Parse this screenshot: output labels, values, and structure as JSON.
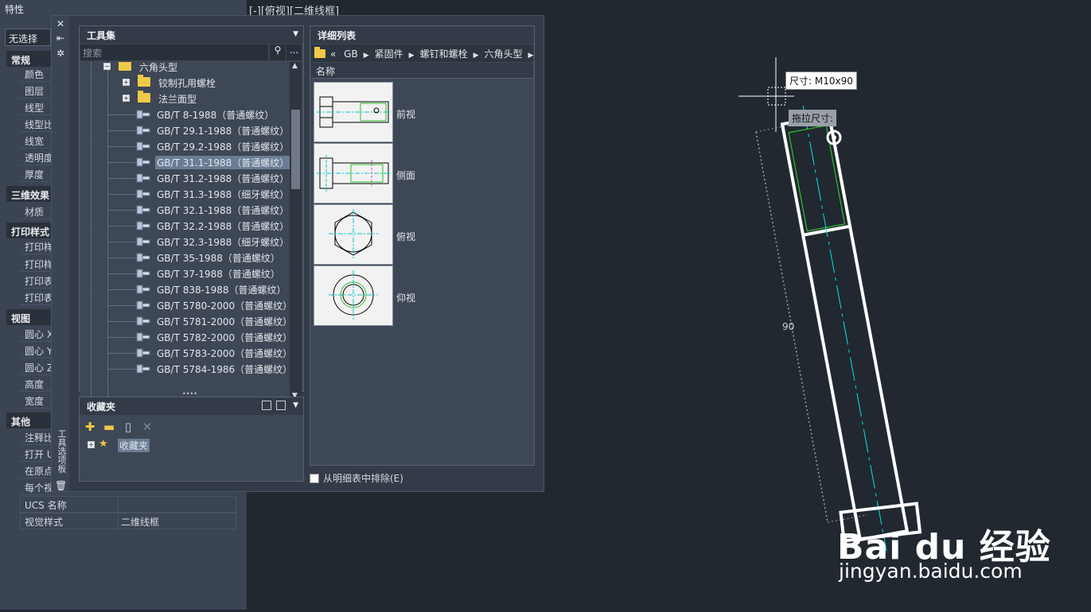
{
  "properties_palette": {
    "title": "特性",
    "selection": "无选择",
    "sections": [
      {
        "name": "常规",
        "rows": [
          "颜色",
          "图层",
          "线型",
          "线型比",
          "线宽",
          "透明度",
          "厚度"
        ]
      },
      {
        "name": "三维效果",
        "rows": [
          "材质"
        ]
      },
      {
        "name": "打印样式",
        "rows": [
          "打印样",
          "打印样",
          "打印表",
          "打印表"
        ]
      },
      {
        "name": "视图",
        "rows": [
          "圆心 X",
          "圆心 Y",
          "圆心 Z",
          "高度",
          "宽度"
        ]
      },
      {
        "name": "其他",
        "rows": [
          "注释比",
          "打开 U",
          "在原点",
          "每个视"
        ]
      }
    ],
    "full_rows": [
      {
        "key": "UCS 名称",
        "value": ""
      },
      {
        "key": "视觉样式",
        "value": "二维线框"
      }
    ]
  },
  "viewport_label": "[-][俯视][二维线框]",
  "tool_palette": {
    "side_title": "工具选项板",
    "toolset": {
      "title": "工具集",
      "search_placeholder": "搜索",
      "more": "...",
      "tree": [
        {
          "label": "六角头型",
          "type": "folder",
          "expand": "−"
        },
        {
          "label": "铰制孔用螺栓",
          "type": "folder",
          "expand": "+"
        },
        {
          "label": "法兰面型",
          "type": "folder",
          "expand": "+"
        },
        {
          "label": "GB/T 8-1988（普通螺纹）",
          "type": "bolt"
        },
        {
          "label": "GB/T 29.1-1988（普通螺纹）",
          "type": "bolt"
        },
        {
          "label": "GB/T 29.2-1988（普通螺纹）",
          "type": "bolt"
        },
        {
          "label": "GB/T 31.1-1988（普通螺纹）",
          "type": "bolt",
          "selected": true
        },
        {
          "label": "GB/T 31.2-1988（普通螺纹）",
          "type": "bolt"
        },
        {
          "label": "GB/T 31.3-1988（细牙螺纹）",
          "type": "bolt"
        },
        {
          "label": "GB/T 32.1-1988（普通螺纹）",
          "type": "bolt"
        },
        {
          "label": "GB/T 32.2-1988（普通螺纹）",
          "type": "bolt"
        },
        {
          "label": "GB/T 32.3-1988（细牙螺纹）",
          "type": "bolt"
        },
        {
          "label": "GB/T 35-1988（普通螺纹）",
          "type": "bolt"
        },
        {
          "label": "GB/T 37-1988（普通螺纹）",
          "type": "bolt"
        },
        {
          "label": "GB/T 838-1988（普通螺纹）",
          "type": "bolt"
        },
        {
          "label": "GB/T 5780-2000（普通螺纹）",
          "type": "bolt"
        },
        {
          "label": "GB/T 5781-2000（普通螺纹）",
          "type": "bolt"
        },
        {
          "label": "GB/T 5782-2000（普通螺纹）",
          "type": "bolt"
        },
        {
          "label": "GB/T 5783-2000（普通螺纹）",
          "type": "bolt"
        },
        {
          "label": "GB/T 5784-1986（普通螺纹）",
          "type": "bolt"
        }
      ]
    },
    "favorites": {
      "title": "收藏夹",
      "item": "收藏夹",
      "tool_icons": [
        "add-favorite-icon",
        "new-folder-icon",
        "document-icon",
        "delete-icon"
      ]
    },
    "detail_list": {
      "title": "详细列表",
      "breadcrumb": [
        "«",
        "GB",
        "紧固件",
        "螺钉和螺栓",
        "六角头型"
      ],
      "column_header": "名称",
      "views": [
        "前视",
        "侧面",
        "俯视",
        "仰视"
      ]
    },
    "exclude_checkbox": "从明细表中排除(E)"
  },
  "canvas": {
    "size_tooltip": "尺寸: M10x90",
    "drag_tooltip": "拖拉尺寸:",
    "dimension": "90"
  },
  "watermark": {
    "brand": "Bai du 经验",
    "url": "jingyan.baidu.com"
  },
  "colors": {
    "background": "#212830",
    "panel": "#3b4453",
    "selection": "#6b7d95",
    "folder": "#f0c948",
    "cyan": "#00e5e5",
    "green": "#2fbf2f"
  }
}
